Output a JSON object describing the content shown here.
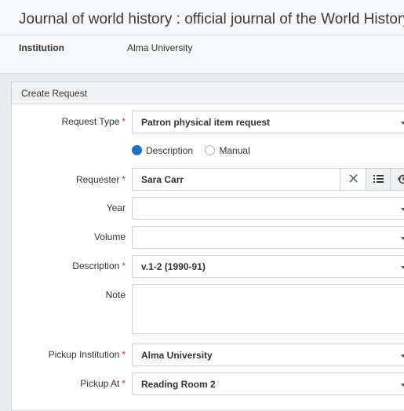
{
  "header": {
    "title": "Journal of world history : official journal of the World History A",
    "institution_label": "Institution",
    "institution_value": "Alma University"
  },
  "panel": {
    "title": "Create Request",
    "request_type": {
      "label": "Request Type",
      "value": "Patron physical item request"
    },
    "radio_options": {
      "description": "Description",
      "manual": "Manual",
      "selected": "Description"
    },
    "requester": {
      "label": "Requester",
      "value": "Sara Carr"
    },
    "year": {
      "label": "Year",
      "value": ""
    },
    "volume": {
      "label": "Volume",
      "value": ""
    },
    "description": {
      "label": "Description",
      "value": "v.1-2 (1990-91)"
    },
    "note": {
      "label": "Note",
      "value": ""
    },
    "pickup_institution": {
      "label": "Pickup Institution",
      "value": "Alma University"
    },
    "pickup_at": {
      "label": "Pickup At",
      "value": "Reading Room 2"
    },
    "required_mark": "*"
  },
  "colors": {
    "required": "#d9262d",
    "radio_selected": "#1f6fc5"
  },
  "icons": {
    "clear": "close-icon",
    "list": "list-icon",
    "history": "history-icon",
    "dropdown": "chevron-down-icon"
  }
}
